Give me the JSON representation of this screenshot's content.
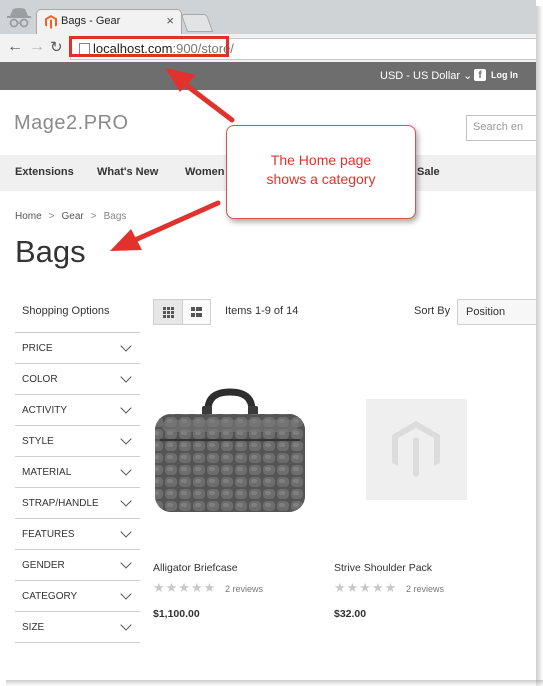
{
  "browser": {
    "tab_title": "Bags - Gear",
    "tab_close": "×",
    "url_host": "localhost.com",
    "url_rest": ":900/store/"
  },
  "header": {
    "currency": "USD - US Dollar",
    "login": "Log In",
    "logo": "Mage2.PRO",
    "search_placeholder": "Search en"
  },
  "menu": [
    "Extensions",
    "What's New",
    "Women",
    "Sale"
  ],
  "breadcrumb": {
    "home": "Home",
    "gear": "Gear",
    "current": "Bags",
    "sep": ">"
  },
  "page_title": "Bags",
  "sidebar": {
    "title": "Shopping Options",
    "filters": [
      "PRICE",
      "COLOR",
      "ACTIVITY",
      "STYLE",
      "MATERIAL",
      "STRAP/HANDLE",
      "FEATURES",
      "GENDER",
      "CATEGORY",
      "SIZE"
    ]
  },
  "toolbar": {
    "items": "Items 1-9 of 14",
    "sort_label": "Sort By",
    "sort_value": "Position"
  },
  "products": [
    {
      "name": "Alligator Briefcase",
      "reviews": "2 reviews",
      "price": "$1,100.00",
      "rating": "★★★★★"
    },
    {
      "name": "Strive Shoulder Pack",
      "reviews": "2 reviews",
      "price": "$32.00",
      "rating": "★★★★★"
    }
  ],
  "callout": {
    "line1": "The Home page",
    "line2": "shows a category"
  },
  "colors": {
    "accent_red": "#e2322d",
    "topbar": "#6e6e6e",
    "menubar": "#f0f0f0"
  }
}
